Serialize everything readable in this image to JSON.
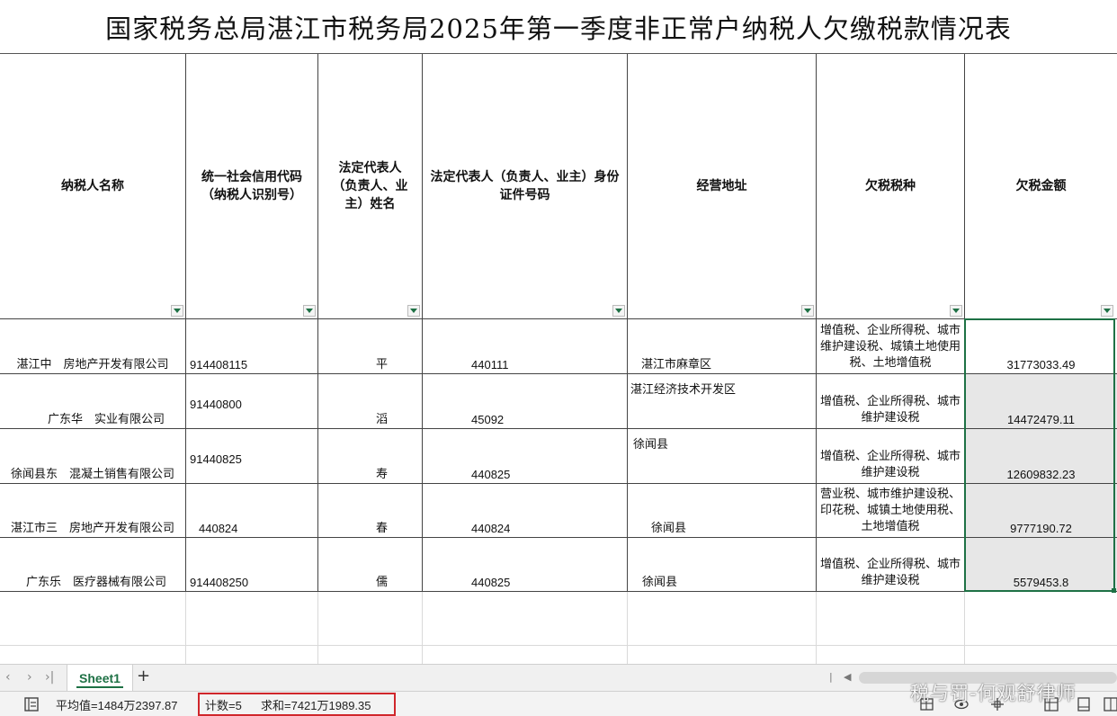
{
  "sheet": {
    "title": "国家税务总局湛江市税务局2025年第一季度非正常户纳税人欠缴税款情况表",
    "headers": [
      "纳税人名称",
      "统一社会信用代码（纳税人识别号）",
      "法定代表人（负责人、业主）姓名",
      "法定代表人（负责人、业主）身份证件号码",
      "经营地址",
      "欠税税种",
      "欠税金额"
    ],
    "rows": [
      {
        "name": "湛江中　房地产开发有限公司",
        "code": "914408115",
        "rep": "平",
        "id": "440111",
        "address": "湛江市麻章区",
        "taxes": "增值税、企业所得税、城市维护建设税、城镇土地使用税、土地增值税",
        "amount": "31773033.49"
      },
      {
        "name": "广东华　实业有限公司",
        "code": "91440800",
        "rep": "滔",
        "id": "45092",
        "address": "湛江经济技术开发区",
        "taxes": "增值税、企业所得税、城市维护建设税",
        "amount": "14472479.11"
      },
      {
        "name": "徐闻县东　混凝土销售有限公司",
        "code": "91440825",
        "rep": "寿",
        "id": "440825",
        "address": "徐闻县",
        "taxes": "增值税、企业所得税、城市维护建设税",
        "amount": "12609832.23"
      },
      {
        "name": "湛江市三　房地产开发有限公司",
        "code": "440824",
        "rep": "春",
        "id": "440824",
        "address": "徐闻县",
        "taxes": "营业税、城市维护建设税、印花税、城镇土地使用税、土地增值税",
        "amount": "9777190.72"
      },
      {
        "name": "广东乐　医疗器械有限公司",
        "code": "914408250",
        "rep": "儒",
        "id": "440825",
        "address": "徐闻县",
        "taxes": "增值税、企业所得税、城市维护建设税",
        "amount": "5579453.8"
      }
    ]
  },
  "tabs": {
    "sheet_name": "Sheet1",
    "add_symbol": "+",
    "nav_prev": "‹",
    "nav_next": "›",
    "nav_last": "›|"
  },
  "status": {
    "average": "平均值=1484万2397.87",
    "count": "计数=5",
    "sum": "求和=7421万1989.35"
  },
  "watermark": "税与罚-何观舒律师",
  "colors": {
    "accent": "#1e7145",
    "highlight": "#d0262b",
    "selected_fill": "#e7e7e7"
  }
}
